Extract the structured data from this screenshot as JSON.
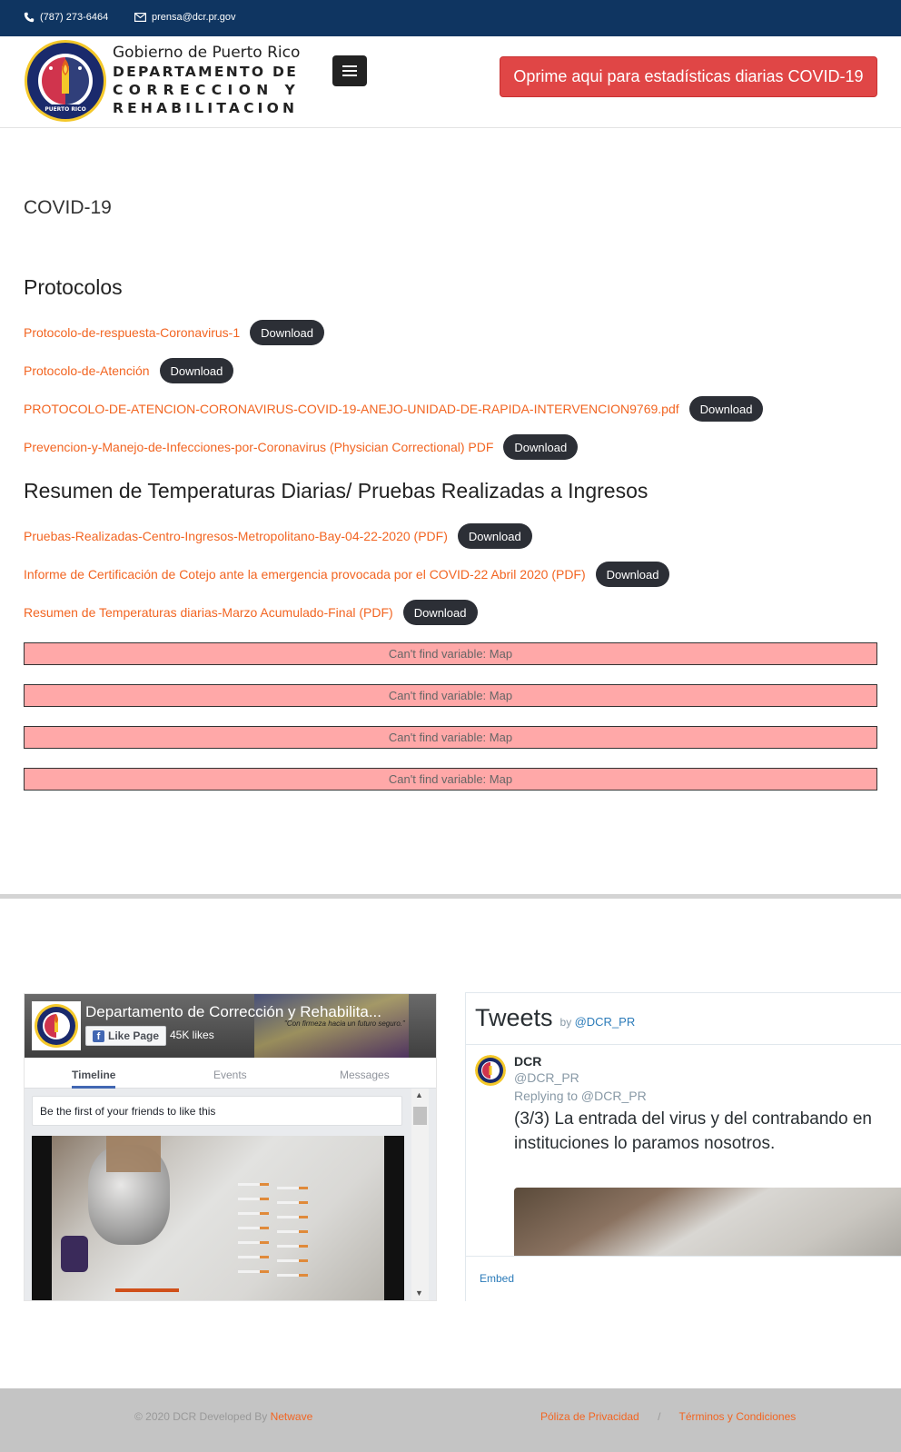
{
  "topbar": {
    "phone": "(787) 273-6464",
    "email": "prensa@dcr.pr.gov"
  },
  "header": {
    "logo_line1": "Gobierno de Puerto Rico",
    "logo_line2": "DEPARTAMENTO DE",
    "logo_line3": "CORRECCION Y",
    "logo_line4": "REHABILITACION",
    "seal_text_top": "DEPARTAMENTO DE CORRECCION Y REHABILITACION",
    "seal_text_bottom": "PUERTO RICO",
    "covid_button": "Oprime aqui para estadísticas diarias COVID-19"
  },
  "main": {
    "page_title": "COVID-19",
    "download_label": "Download",
    "sections": [
      {
        "heading": "Protocolos",
        "items": [
          {
            "title": "Protocolo-de-respuesta-Coronavirus-1"
          },
          {
            "title": "Protocolo-de-Atención"
          },
          {
            "title": "PROTOCOLO-DE-ATENCION-CORONAVIRUS-COVID-19-ANEJO-UNIDAD-DE-RAPIDA-INTERVENCION9769.pdf"
          },
          {
            "title": "Prevencion-y-Manejo-de-Infecciones-por-Coronavirus (Physician Correctional) PDF"
          }
        ]
      },
      {
        "heading": "Resumen de Temperaturas Diarias/ Pruebas Realizadas a Ingresos",
        "items": [
          {
            "title": "Pruebas-Realizadas-Centro-Ingresos-Metropolitano-Bay-04-22-2020 (PDF)"
          },
          {
            "title": "Informe de Certificación de Cotejo ante la emergencia provocada por el COVID-22 Abril 2020 (PDF)"
          },
          {
            "title": "Resumen de Temperaturas diarias-Marzo Acumulado-Final (PDF)"
          }
        ]
      }
    ],
    "errors": [
      "Can't find variable: Map",
      "Can't find variable: Map",
      "Can't find variable: Map",
      "Can't find variable: Map"
    ]
  },
  "facebook": {
    "page_name": "Departamento de Corrección y Rehabilita...",
    "like_button": "Like Page",
    "likes": "45K likes",
    "slogan": "\"Con firmeza hacia un futuro seguro.\"",
    "tabs": [
      "Timeline",
      "Events",
      "Messages"
    ],
    "friends_text": "Be the first of your friends to like this"
  },
  "twitter": {
    "title": "Tweets",
    "by": "by",
    "handle_link": "@DCR_PR",
    "author_name": "DCR",
    "author_handle": "@DCR_PR",
    "replying_to": "Replying to @DCR_PR",
    "tweet_line1": "(3/3) La entrada del virus y del contrabando en",
    "tweet_line2": "instituciones lo paramos nosotros.",
    "embed": "Embed"
  },
  "footer": {
    "copyright": "© 2020 DCR Developed By",
    "developer": "Netwave",
    "privacy": "Póliza de Privacidad",
    "separator": "/",
    "terms": "Términos y Condiciones"
  },
  "colors": {
    "topbar": "#0f3561",
    "link": "#f26522",
    "covid_button": "#e04646",
    "download_button": "#2c2f36",
    "error_bg": "#ffa8a8",
    "footer_bg": "#c4c4c4"
  }
}
